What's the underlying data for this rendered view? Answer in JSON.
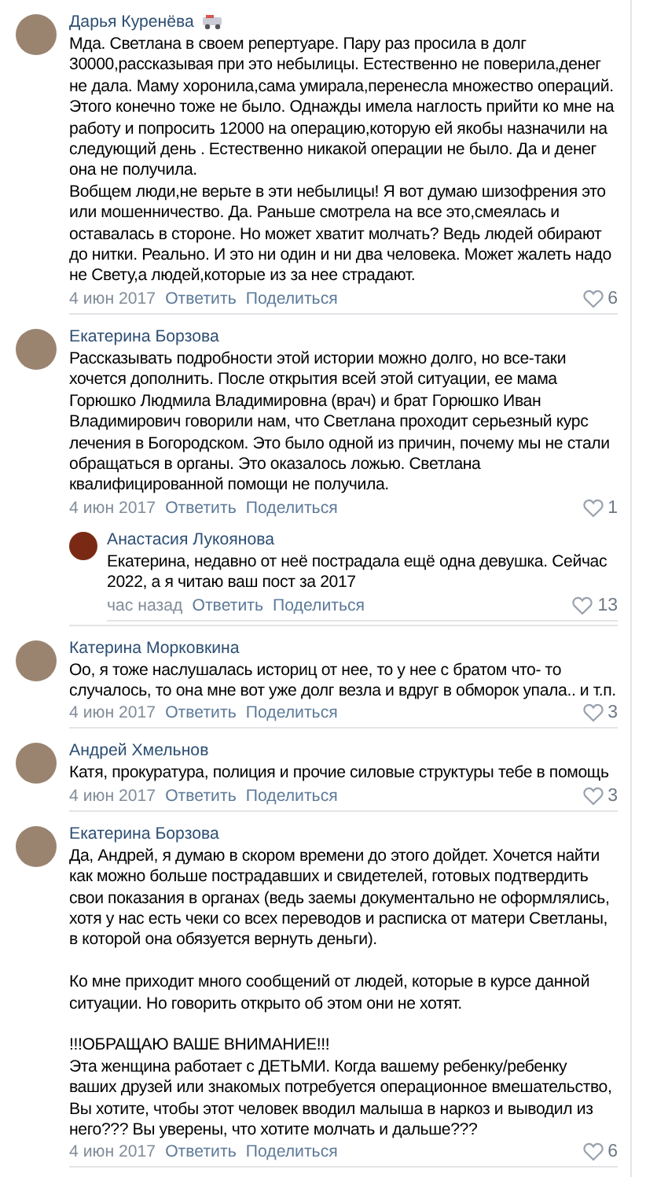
{
  "comments": [
    {
      "author": "Дарья Куренёва",
      "author_badge": true,
      "text": "Мда. Светлана в своем репертуаре. Пару раз просила в долг 30000,рассказывая при это небылицы. Естественно не поверила,денег не дала. Маму хоронила,сама умирала,перенесла множество операций. Этого конечно тоже не было. Однажды имела наглость прийти ко мне на работу и попросить 12000 на операцию,которую ей якобы назначили на следующий день . Естественно никакой операции не было. Да и денег она не получила.\nВобщем люди,не верьте в эти небылицы! Я вот думаю шизофрения это или мошенничество. Да. Раньше смотрела на все это,смеялась и оставалась в стороне. Но может хватит молчать? Ведь людей обирают до нитки. Реально. И это ни один и ни два человека. Может жалеть надо не Свету,а людей,которые из за нее страдают.",
      "date": "4 июн 2017",
      "reply": "Ответить",
      "share": "Поделиться",
      "likes": "6"
    },
    {
      "author": "Екатерина Борзова",
      "author_badge": false,
      "text": "Рассказывать подробности этой истории можно долго, но все-таки хочется дополнить. После открытия всей этой ситуации, ее мама Горюшко Людмила Владимировна (врач) и брат Горюшко Иван Владимирович говорили нам, что Светлана проходит серьезный курс лечения в Богородском. Это было одной из причин, почему мы не стали обращаться в органы. Это оказалось ложью. Светлана квалифицированной помощи не получила.",
      "date": "4 июн 2017",
      "reply": "Ответить",
      "share": "Поделиться",
      "likes": "1",
      "replies": [
        {
          "author": "Анастасия Лукоянова",
          "author_badge": false,
          "text": "Екатерина, недавно от неё пострадала ещё одна девушка. Сейчас 2022, а я читаю ваш пост за 2017",
          "date": "час назад",
          "reply": "Ответить",
          "share": "Поделиться",
          "likes": "13"
        }
      ]
    },
    {
      "author": "Катерина Морковкина",
      "author_badge": false,
      "text": "Оо, я тоже наслушалась историц от нее, то у нее с братом что- то случалось, то она мне вот уже долг везла и вдруг в обморок упала.. и т.п.",
      "date": "4 июн 2017",
      "reply": "Ответить",
      "share": "Поделиться",
      "likes": "3"
    },
    {
      "author": "Андрей Хмельнов",
      "author_badge": false,
      "text": "Катя, прокуратура, полиция и прочие силовые структуры тебе в помощь",
      "date": "4 июн 2017",
      "reply": "Ответить",
      "share": "Поделиться",
      "likes": "3"
    },
    {
      "author": "Екатерина Борзова",
      "author_badge": false,
      "text": "Да, Андрей, я думаю в скором времени до этого дойдет. Хочется найти как можно больше пострадавших и свидетелей, готовых подтвердить свои показания в органах (ведь заемы документально не оформлялись, хотя у нас есть чеки со всех переводов и расписка от матери Светланы, в которой она обязуется вернуть деньги).\n\nКо мне приходит много сообщений от людей, которые в курсе данной ситуации. Но говорить открыто об этом они не хотят.\n\n!!!ОБРАЩАЮ ВАШЕ ВНИМАНИЕ!!!\nЭта женщина работает с ДЕТЬМИ. Когда вашему ребенку/ребенку ваших друзей или знакомых потребуется операционное вмешательство, Вы хотите, чтобы этот человек вводил малыша в наркоз и выводил из него??? Вы уверены, что хотите молчать и дальше???",
      "date": "4 июн 2017",
      "reply": "Ответить",
      "share": "Поделиться",
      "likes": "6"
    }
  ]
}
